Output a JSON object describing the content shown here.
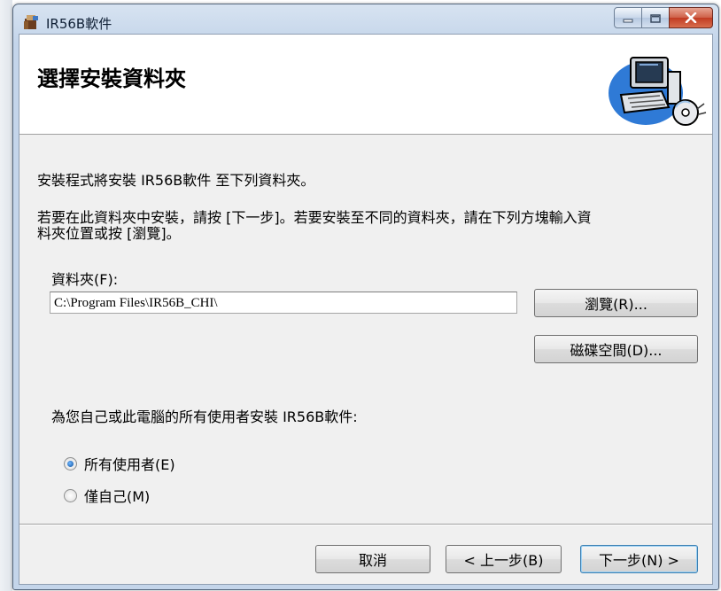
{
  "window": {
    "title": "IR56B軟件",
    "minimize_label": "minimize",
    "maximize_label": "maximize",
    "close_label": "close"
  },
  "banner": {
    "title": "選擇安裝資料夾",
    "art_icon": "computer-cd-icon"
  },
  "body": {
    "intro_line": "安裝程式將安裝 IR56B軟件 至下列資料夾。",
    "instruction_line1": "若要在此資料夾中安裝，請按 [下一步]。若要安裝至不同的資料夾，請在下列方塊輸入資",
    "instruction_line2": "料夾位置或按 [瀏覽]。",
    "folder_label": "資料夾(F):",
    "folder_value": "C:\\Program Files\\IR56B_CHI\\",
    "browse_button": "瀏覽(R)...",
    "disk_space_button": "磁碟空間(D)...",
    "users_label": "為您自己或此電腦的所有使用者安裝 IR56B軟件:",
    "radio_all": "所有使用者(E)",
    "radio_me": "僅自己(M)",
    "selected_option": "所有使用者(E)"
  },
  "footer": {
    "cancel": "取消",
    "back": "< 上一步(B)",
    "next": "下一步(N) >"
  }
}
